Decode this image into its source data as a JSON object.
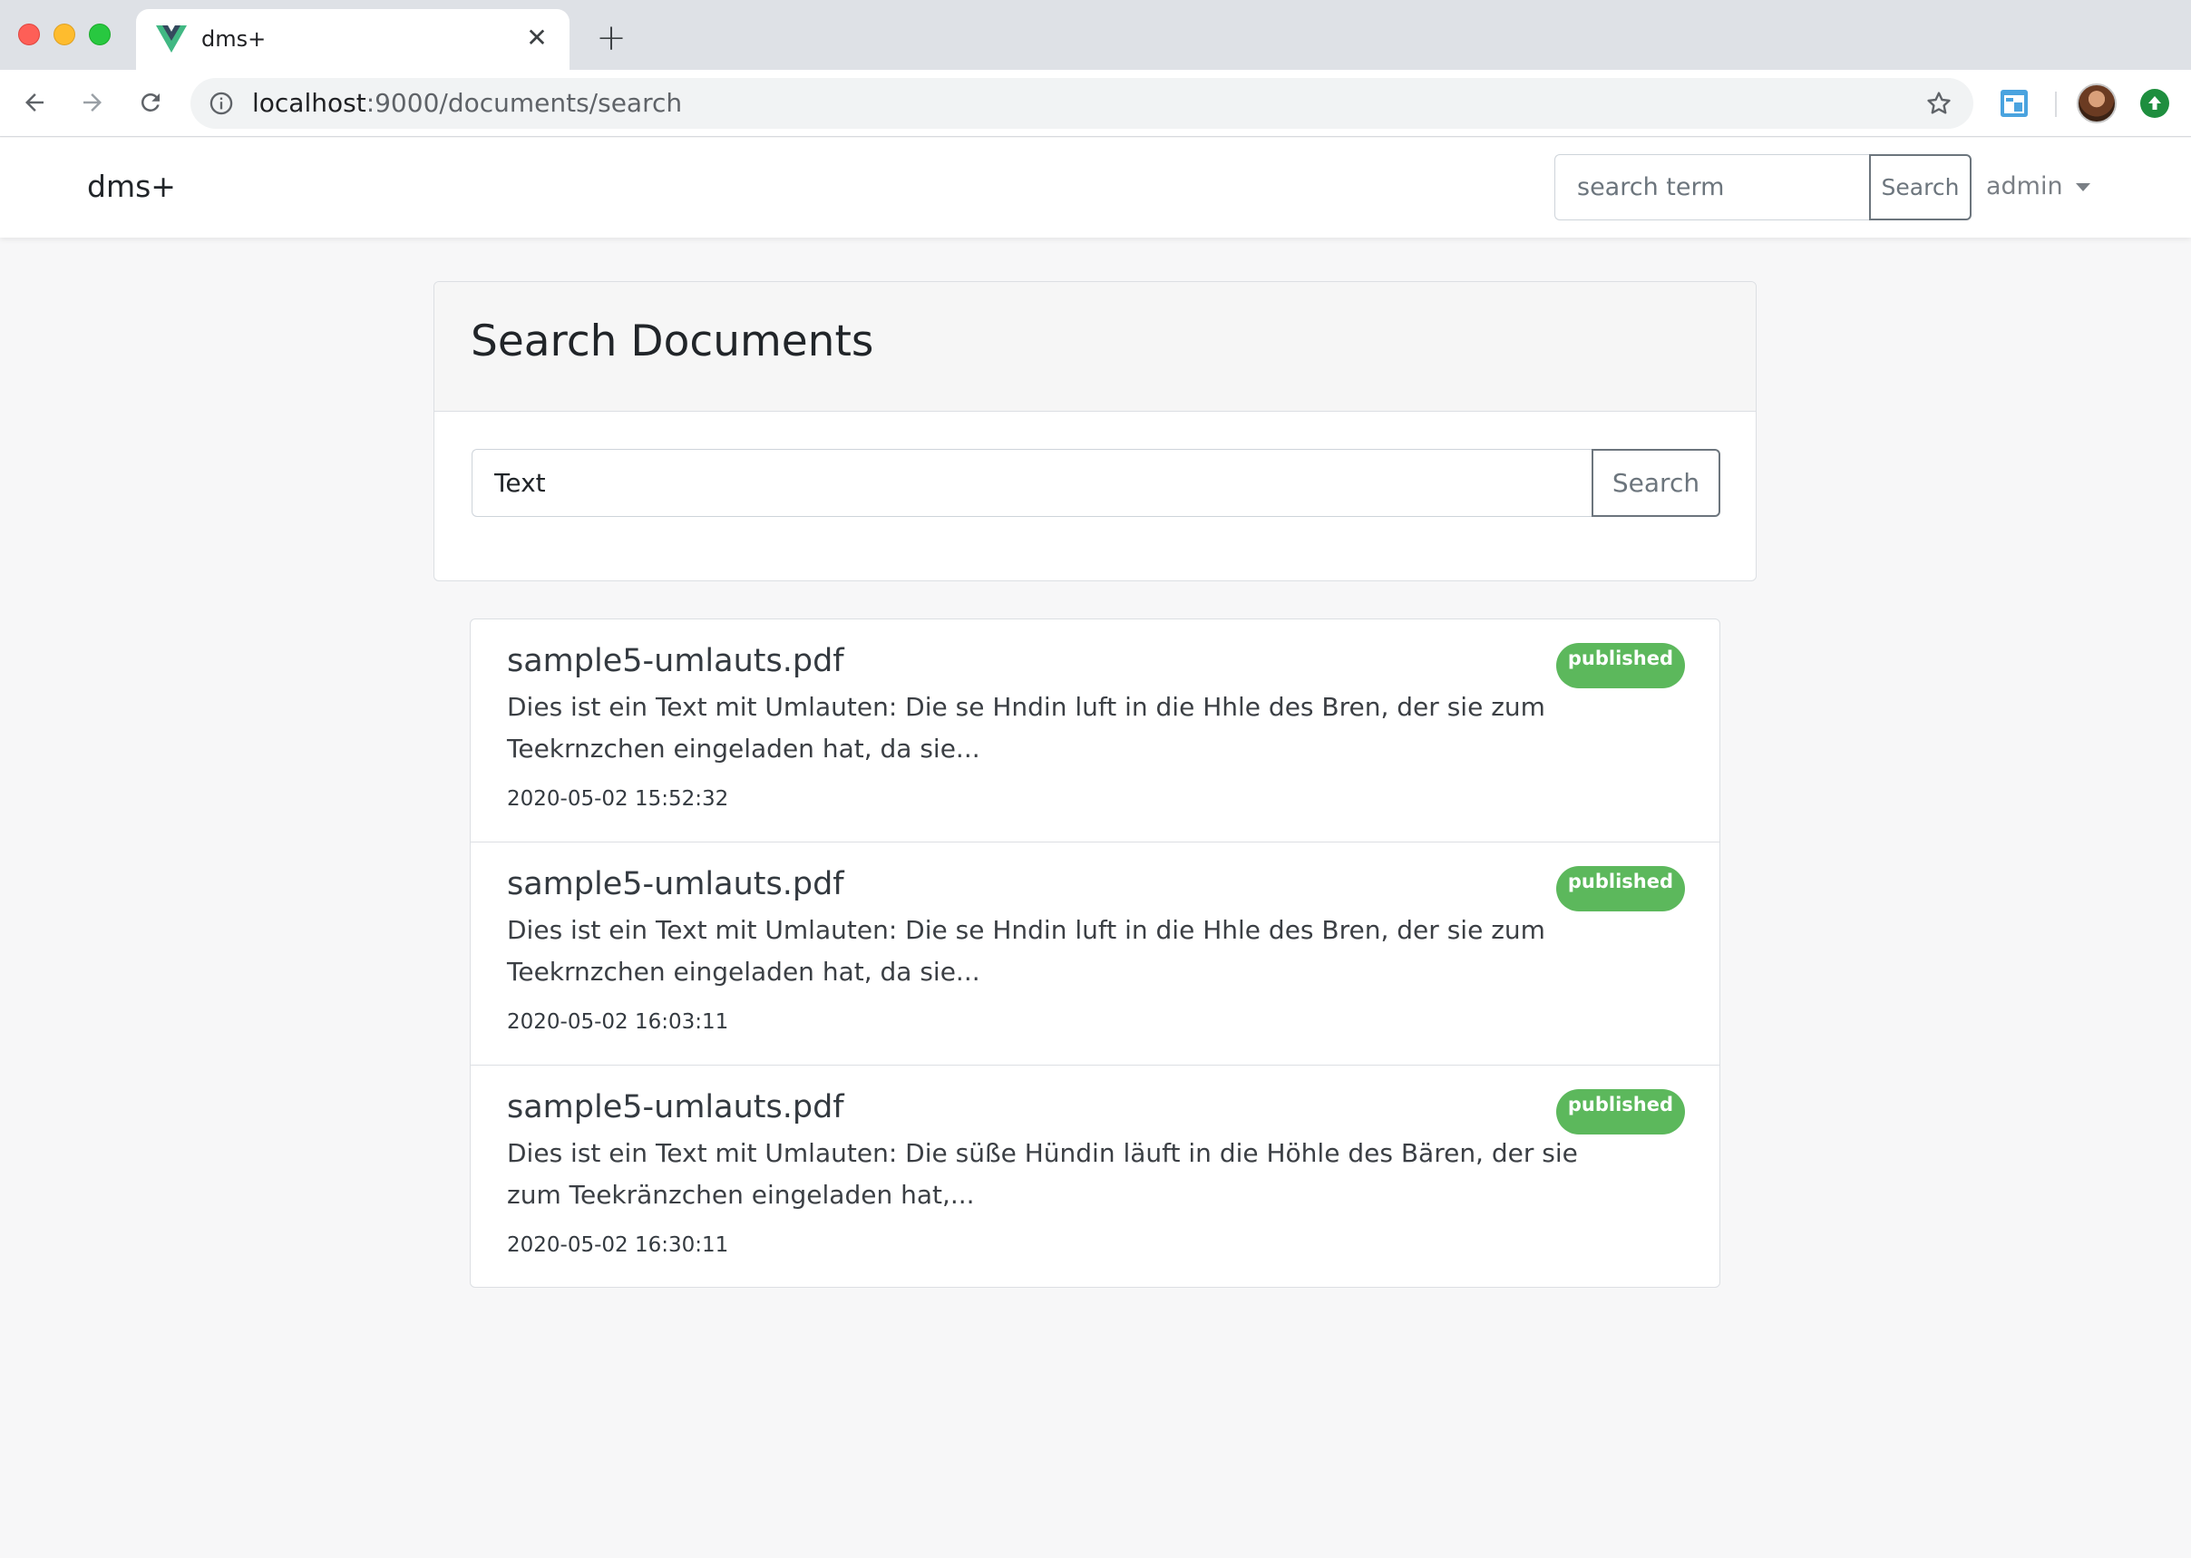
{
  "browser": {
    "tab_title": "dms+",
    "tab_close_glyph": "✕",
    "new_tab_glyph": "+",
    "url_host": "localhost",
    "url_path": ":9000/documents/search",
    "icons": [
      "vue-favicon-icon",
      "back-arrow-icon",
      "forward-arrow-icon",
      "reload-icon",
      "info-icon",
      "star-icon",
      "extension-icon",
      "avatar",
      "update-icon"
    ]
  },
  "navbar": {
    "brand": "dms+",
    "search_placeholder": "search term",
    "search_button": "Search",
    "user_menu": "admin"
  },
  "search_card": {
    "title": "Search Documents",
    "query": "Text",
    "search_button": "Search"
  },
  "results": [
    {
      "title": "sample5-umlauts.pdf",
      "status": "published",
      "snippet": "Dies ist ein Text mit Umlauten: Die se Hndin luft in die Hhle des Bren, der sie zum Teekrnzchen eingeladen hat, da sie...",
      "date": "2020-05-02 15:52:32"
    },
    {
      "title": "sample5-umlauts.pdf",
      "status": "published",
      "snippet": "Dies ist ein Text mit Umlauten: Die se Hndin luft in die Hhle des Bren, der sie zum Teekrnzchen eingeladen hat, da sie...",
      "date": "2020-05-02 16:03:11"
    },
    {
      "title": "sample5-umlauts.pdf",
      "status": "published",
      "snippet": "Dies ist ein Text mit Umlauten: Die süße Hündin läuft in die Höhle des Bären, der sie zum Teekränzchen eingeladen hat,...",
      "date": "2020-05-02 16:30:11"
    }
  ],
  "colors": {
    "badge_published": "#5cb85c",
    "page_background": "#f7f7f8",
    "button_border": "#6c757d"
  }
}
